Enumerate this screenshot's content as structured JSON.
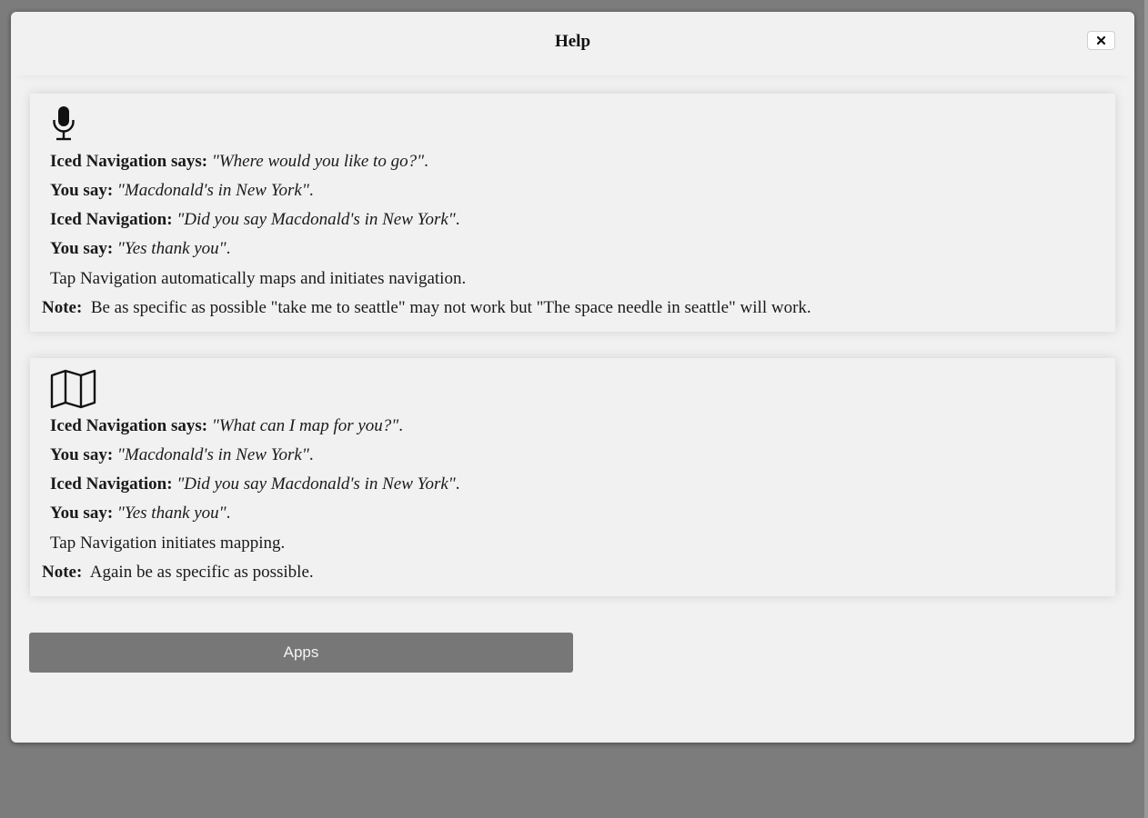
{
  "dialog": {
    "title": "Help",
    "close_label": "×"
  },
  "voice_card": {
    "icon": "microphone-icon",
    "lines": [
      {
        "speaker": "Iced Navigation says:",
        "text": "\"Where would you like to go?\"",
        "end": "."
      },
      {
        "speaker": "You say:",
        "text": "\"Macdonald's in New York\"",
        "end": "."
      },
      {
        "speaker": "Iced Navigation:",
        "text": "\"Did you say Macdonald's in New York\"",
        "end": "."
      },
      {
        "speaker": "You say:",
        "text": "\"Yes thank you\"",
        "end": "."
      }
    ],
    "description": "Tap Navigation automatically maps and initiates navigation.",
    "note_label": "Note:",
    "note_text": "Be as specific as possible \"take me to seattle\" may not work but \"The space needle in seattle\" will work."
  },
  "map_card": {
    "icon": "map-icon",
    "lines": [
      {
        "speaker": "Iced Navigation says:",
        "text": "\"What can I map for you?\"",
        "end": "."
      },
      {
        "speaker": "You say:",
        "text": "\"Macdonald's in New York\"",
        "end": "."
      },
      {
        "speaker": "Iced Navigation:",
        "text": "\"Did you say Macdonald's in New York\"",
        "end": "."
      },
      {
        "speaker": "You say:",
        "text": "\"Yes thank you\"",
        "end": "."
      }
    ],
    "description": "Tap Navigation initiates mapping.",
    "note_label": "Note:",
    "note_text": "Again be as specific as possible."
  },
  "apps_button": {
    "label": "Apps"
  },
  "colors": {
    "backdrop": "#7c7c7c",
    "dialog_bg": "#f1f1f1",
    "button_bg": "#777777"
  }
}
